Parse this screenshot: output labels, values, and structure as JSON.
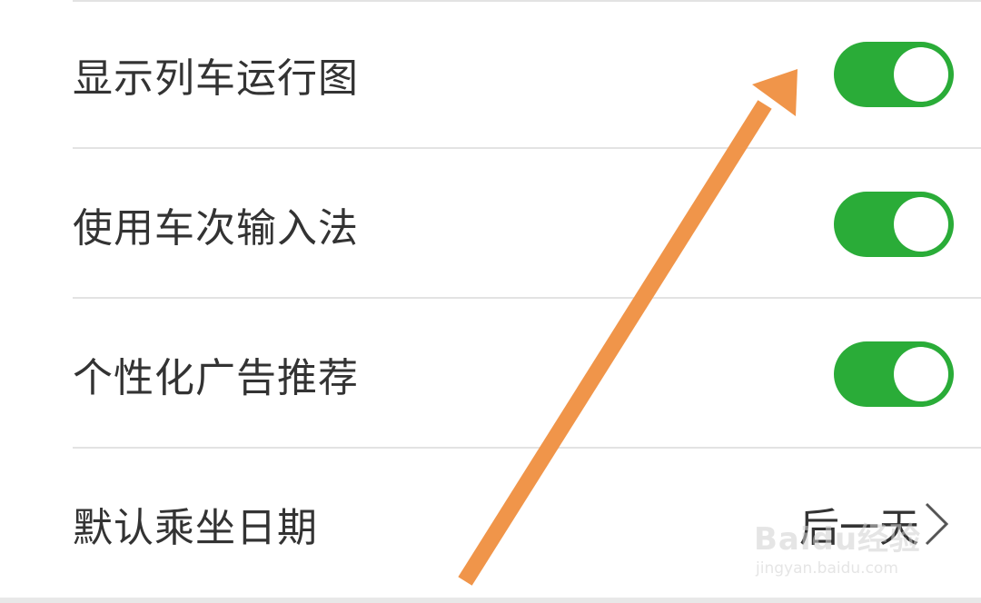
{
  "settings": {
    "items": [
      {
        "label": "显示列车运行图",
        "control": "toggle",
        "on": true
      },
      {
        "label": "使用车次输入法",
        "control": "toggle",
        "on": true
      },
      {
        "label": "个性化广告推荐",
        "control": "toggle",
        "on": true
      },
      {
        "label": "默认乘坐日期",
        "control": "value",
        "value": "后一天"
      }
    ]
  },
  "watermark": {
    "brand": "Baidu经验",
    "url": "jingyan.baidu.com"
  },
  "colors": {
    "toggle_on": "#2aac38",
    "arrow": "#f0954a",
    "text": "#333333",
    "divider": "#e3e3e3"
  },
  "icons": {
    "chevron": "chevron-right-icon",
    "annotation": "orange-arrow-icon"
  }
}
